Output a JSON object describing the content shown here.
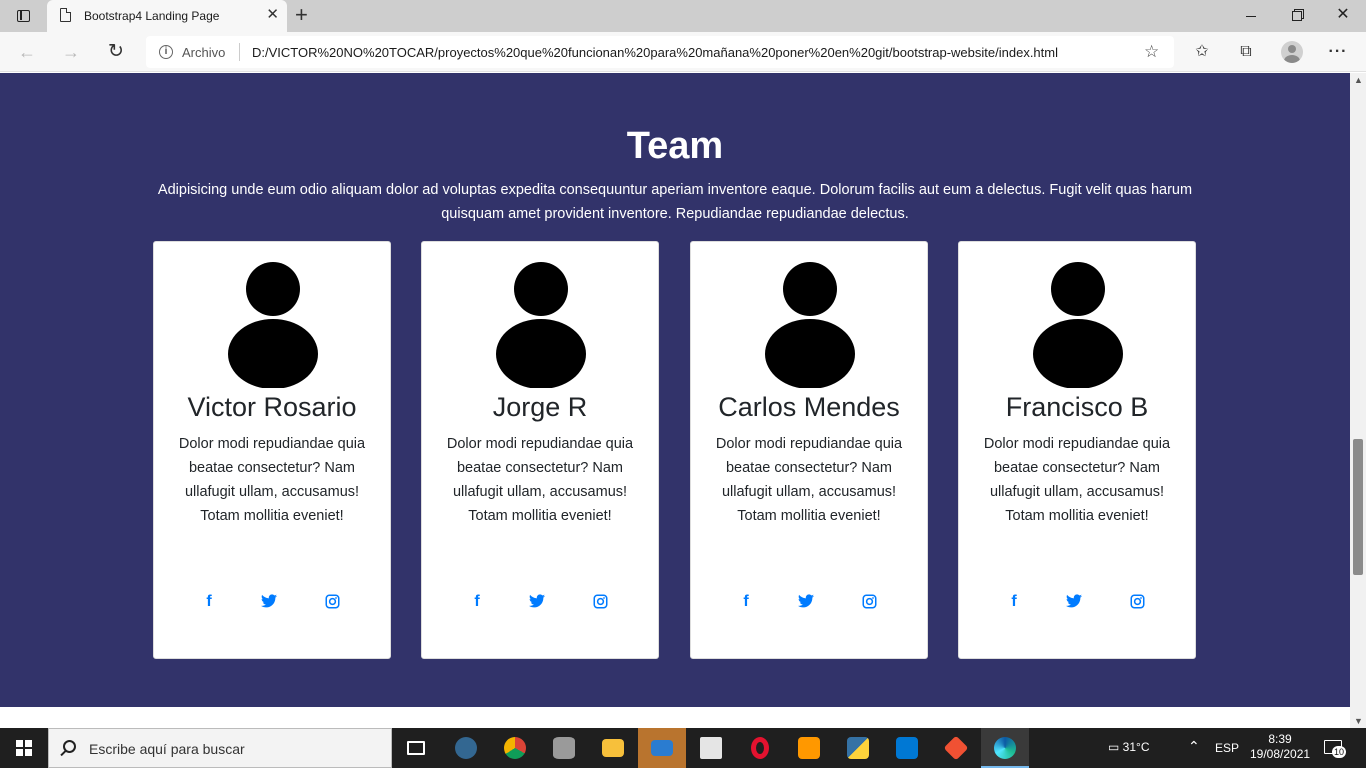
{
  "browser": {
    "tab_title": "Bootstrap4 Landing Page",
    "address_label": "Archivo",
    "url": "D:/VICTOR%20NO%20TOCAR/proyectos%20que%20funcionan%20para%20mañana%20poner%20en%20git/bootstrap-website/index.html"
  },
  "team": {
    "title": "Team",
    "description": "Adipisicing unde eum odio aliquam dolor ad voluptas expedita consequuntur aperiam inventore eaque. Dolorum facilis aut eum a delectus. Fugit velit quas harum quisquam amet provident inventore. Repudiandae repudiandae delectus.",
    "members": [
      {
        "name": "Victor Rosario",
        "bio": "Dolor modi repudiandae quia beatae consectetur? Nam ullafugit ullam, accusamus! Totam mollitia eveniet!"
      },
      {
        "name": "Jorge R",
        "bio": "Dolor modi repudiandae quia beatae consectetur? Nam ullafugit ullam, accusamus! Totam mollitia eveniet!"
      },
      {
        "name": "Carlos Mendes",
        "bio": "Dolor modi repudiandae quia beatae consectetur? Nam ullafugit ullam, accusamus! Totam mollitia eveniet!"
      },
      {
        "name": "Francisco B",
        "bio": "Dolor modi repudiandae quia beatae consectetur? Nam ullafugit ullam, accusamus! Totam mollitia eveniet!"
      }
    ],
    "social_icons": [
      "facebook-icon",
      "twitter-icon",
      "instagram-icon"
    ],
    "accent_color": "#007bff",
    "section_bg": "#32336a"
  },
  "taskbar": {
    "search_placeholder": "Escribe aquí para buscar",
    "weather": "31°C",
    "language": "ESP",
    "time": "8:39",
    "date": "19/08/2021",
    "notifications": "10"
  }
}
